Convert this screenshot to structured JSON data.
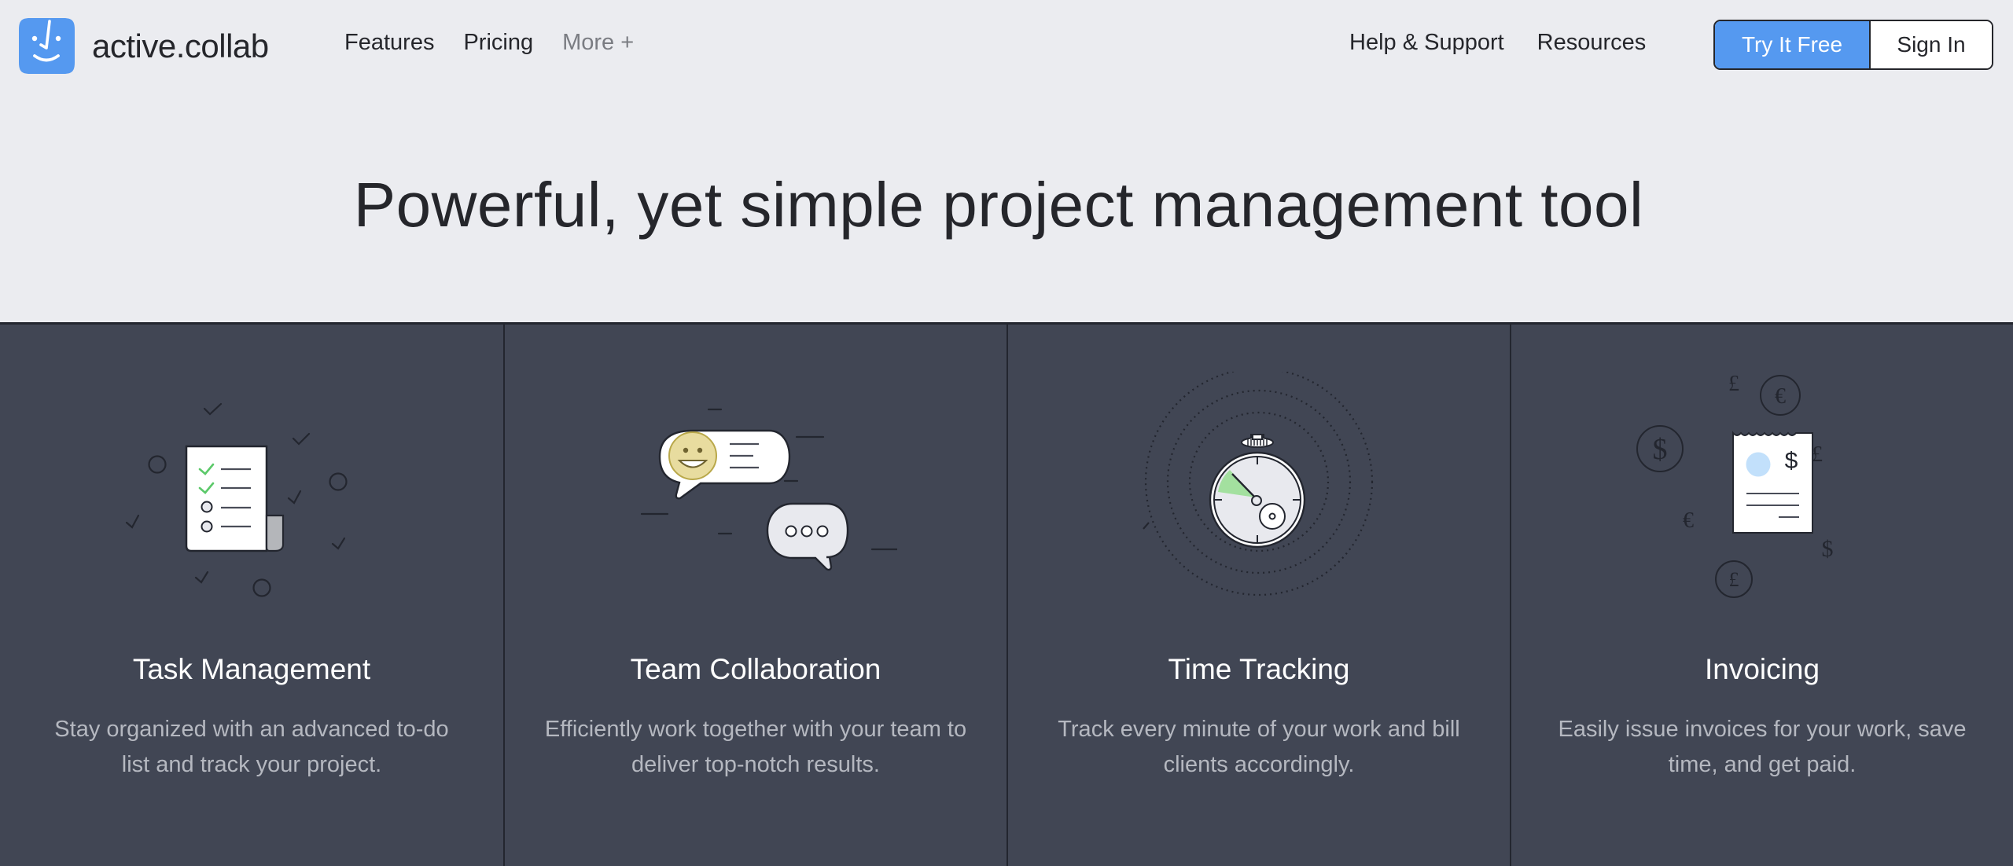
{
  "brand": {
    "name": "active.collab",
    "logo_icon": "smiley-face-logo-icon",
    "accent": "#5599f0"
  },
  "nav": {
    "left": [
      {
        "label": "Features"
      },
      {
        "label": "Pricing"
      },
      {
        "label": "More +"
      }
    ],
    "right": [
      {
        "label": "Help & Support"
      },
      {
        "label": "Resources"
      }
    ],
    "try_free": "Try It Free",
    "sign_in": "Sign In"
  },
  "hero": {
    "title": "Powerful, yet simple project management tool"
  },
  "features": [
    {
      "title": "Task Management",
      "description": "Stay organized with an advanced to-do list and track your project.",
      "icon": "checklist-icon"
    },
    {
      "title": "Team Collaboration",
      "description": "Efficiently work together with your team to deliver top-notch results.",
      "icon": "chat-bubbles-icon"
    },
    {
      "title": "Time Tracking",
      "description": "Track every minute of your work and bill clients accordingly.",
      "icon": "stopwatch-icon"
    },
    {
      "title": "Invoicing",
      "description": "Easily issue invoices for your work, save time, and get paid.",
      "icon": "invoice-receipt-icon"
    }
  ],
  "colors": {
    "page_bg": "#ebecf0",
    "features_bg": "#414654",
    "divider": "#23262f",
    "check_green": "#5cc96a",
    "smiley_yellow": "#e8dc9f",
    "timer_green": "#a3e09f",
    "invoice_blue": "#c2e0fb"
  }
}
